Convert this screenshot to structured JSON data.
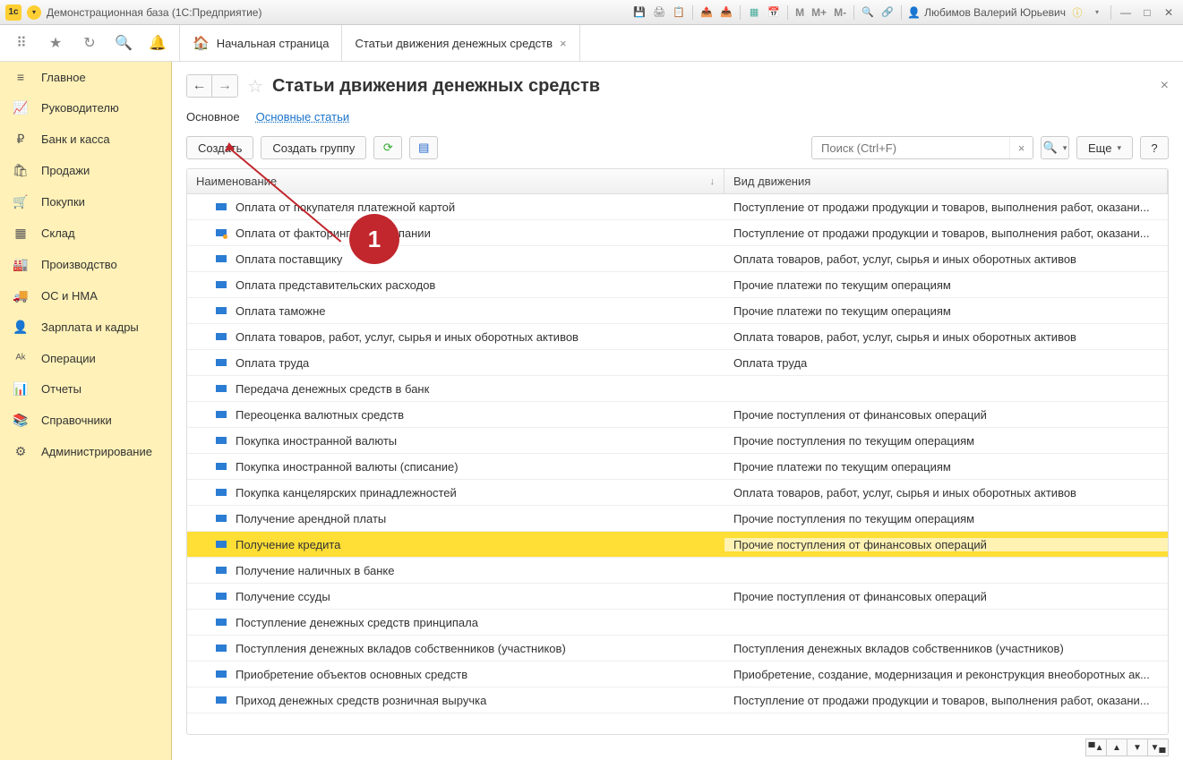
{
  "titlebar": {
    "title": "Демонстрационная база  (1С:Предприятие)",
    "user": "Любимов Валерий Юрьевич",
    "m_btns": [
      "M",
      "M+",
      "M-"
    ]
  },
  "topbar": {
    "home_tab": "Начальная страница",
    "active_tab": "Статьи движения денежных средств"
  },
  "sidebar": {
    "items": [
      {
        "icon": "≡",
        "label": "Главное"
      },
      {
        "icon": "📈",
        "label": "Руководителю"
      },
      {
        "icon": "₽",
        "label": "Банк и касса"
      },
      {
        "icon": "🛍",
        "label": "Продажи"
      },
      {
        "icon": "🛒",
        "label": "Покупки"
      },
      {
        "icon": "▦",
        "label": "Склад"
      },
      {
        "icon": "🏭",
        "label": "Производство"
      },
      {
        "icon": "🚚",
        "label": "ОС и НМА"
      },
      {
        "icon": "👤",
        "label": "Зарплата и кадры"
      },
      {
        "icon": "ᴬᵏ",
        "label": "Операции"
      },
      {
        "icon": "📊",
        "label": "Отчеты"
      },
      {
        "icon": "📚",
        "label": "Справочники"
      },
      {
        "icon": "⚙",
        "label": "Администрирование"
      }
    ]
  },
  "page": {
    "title": "Статьи движения денежных средств",
    "subtabs": {
      "main": "Основное",
      "link": "Основные статьи"
    },
    "toolbar": {
      "create": "Создать",
      "create_group": "Создать группу",
      "search_placeholder": "Поиск (Ctrl+F)",
      "more": "Еще",
      "help": "?"
    },
    "columns": {
      "name": "Наименование",
      "type": "Вид движения"
    },
    "rows": [
      {
        "name": "Оплата от покупателя платежной картой",
        "type": "Поступление от продажи продукции и товаров, выполнения работ, оказани...",
        "warn": false
      },
      {
        "name": "Оплата от факторинговой компании",
        "type": "Поступление от продажи продукции и товаров, выполнения работ, оказани...",
        "warn": true
      },
      {
        "name": "Оплата поставщику",
        "type": "Оплата товаров, работ, услуг, сырья и иных оборотных активов",
        "warn": false
      },
      {
        "name": "Оплата представительских расходов",
        "type": "Прочие платежи по текущим операциям",
        "warn": false
      },
      {
        "name": "Оплата таможне",
        "type": "Прочие платежи по текущим операциям",
        "warn": false
      },
      {
        "name": "Оплата товаров, работ, услуг, сырья и иных оборотных активов",
        "type": "Оплата товаров, работ, услуг, сырья и иных оборотных активов",
        "warn": false
      },
      {
        "name": "Оплата труда",
        "type": "Оплата труда",
        "warn": false
      },
      {
        "name": "Передача денежных средств в банк",
        "type": "",
        "warn": false
      },
      {
        "name": "Переоценка валютных средств",
        "type": "Прочие поступления от финансовых операций",
        "warn": false
      },
      {
        "name": "Покупка иностранной валюты",
        "type": "Прочие поступления по текущим операциям",
        "warn": false
      },
      {
        "name": "Покупка иностранной валюты (списание)",
        "type": "Прочие платежи по текущим операциям",
        "warn": false
      },
      {
        "name": "Покупка канцелярских принадлежностей",
        "type": "Оплата товаров, работ, услуг, сырья и иных оборотных активов",
        "warn": false
      },
      {
        "name": "Получение арендной платы",
        "type": "Прочие поступления по текущим операциям",
        "warn": false
      },
      {
        "name": "Получение кредита",
        "type": "Прочие поступления от финансовых операций",
        "warn": false,
        "selected": true
      },
      {
        "name": "Получение наличных в банке",
        "type": "",
        "warn": false
      },
      {
        "name": "Получение ссуды",
        "type": "Прочие поступления от финансовых операций",
        "warn": false
      },
      {
        "name": "Поступление денежных средств принципала",
        "type": "",
        "warn": false
      },
      {
        "name": "Поступления денежных вкладов собственников (участников)",
        "type": "Поступления денежных вкладов собственников (участников)",
        "warn": false
      },
      {
        "name": "Приобретение объектов основных средств",
        "type": "Приобретение, создание, модернизация и реконструкция внеоборотных ак...",
        "warn": false
      },
      {
        "name": "Приход денежных средств розничная выручка",
        "type": "Поступление от продажи продукции и товаров, выполнения работ, оказани...",
        "warn": false
      }
    ]
  },
  "annotation": {
    "number": "1"
  }
}
